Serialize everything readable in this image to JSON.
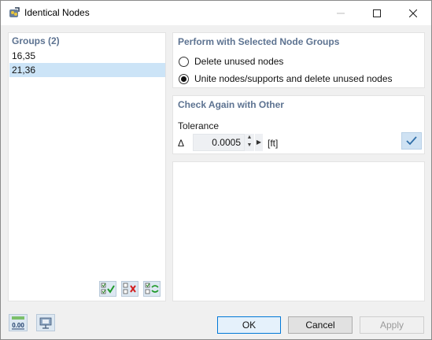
{
  "window": {
    "title": "Identical Nodes",
    "icons": {
      "app": "identical-nodes-app-icon",
      "minimize": "minimize-icon",
      "maximize": "maximize-icon",
      "close": "close-icon"
    }
  },
  "groups": {
    "header": "Groups (2)",
    "items": [
      {
        "label": "16,35",
        "selected": false
      },
      {
        "label": "21,36",
        "selected": true
      }
    ],
    "buttons": [
      "select-all-icon",
      "deselect-all-icon",
      "invert-selection-icon"
    ]
  },
  "perform": {
    "title": "Perform with Selected Node Groups",
    "options": [
      {
        "label": "Delete unused nodes",
        "checked": false
      },
      {
        "label": "Unite nodes/supports and delete unused nodes",
        "checked": true
      }
    ]
  },
  "check_again": {
    "title": "Check Again with Other",
    "tolerance_label": "Tolerance",
    "delta_symbol": "Δ",
    "tolerance_value": "0.0005",
    "unit": "[ft]"
  },
  "footer": {
    "icons": [
      "units-decimal-icon",
      "display-settings-icon"
    ],
    "ok": "OK",
    "cancel": "Cancel",
    "apply": "Apply"
  },
  "colors": {
    "accent": "#5d7391",
    "selection": "#cce4f7",
    "ok_border": "#0078d7"
  }
}
